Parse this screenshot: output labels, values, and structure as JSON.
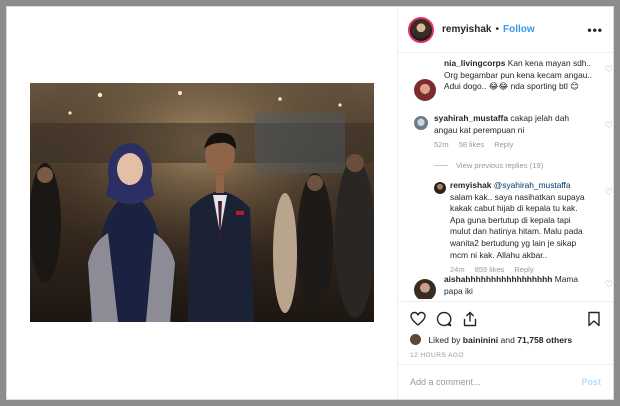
{
  "header": {
    "username": "remyishak",
    "separator": "•",
    "follow_label": "Follow",
    "more_label": "•••"
  },
  "comments": [
    {
      "username": "nia_livingcorps",
      "text": "Kan kena mayan sdh.. Org begambar pun kena kecam angau.. Adui dogo.. 😂😂 nda sporting btl 😊"
    },
    {
      "username": "syahirah_mustaffa",
      "text": "cakap jelah dah angau kat perempuan ni",
      "time": "52m",
      "likes": "58 likes",
      "reply": "Reply"
    },
    {
      "view_replies": "View previous replies (19)"
    },
    {
      "username": "remyishak",
      "mention": "@syahirah_mustaffa",
      "text": "salam kak.. saya nasihatkan supaya kakak cabut hijab di kepala tu kak. Apa guna bertutup di kepala tapi mulut dan hatinya hitam. Malu pada wanita2 bertudung yg lain je sikap mcm ni kak. Allahu akbar..",
      "time": "24m",
      "likes": "859 likes",
      "reply": "Reply"
    },
    {
      "username": "aishahhhhhhhhhhhhhhhhh",
      "text": "Mama papa iki"
    }
  ],
  "likes": {
    "prefix": "Liked by",
    "user": "baininini",
    "and": "and",
    "count": "71,758 others"
  },
  "timestamp": "12 HOURS AGO",
  "add_comment": {
    "placeholder": "Add a comment...",
    "post_label": "Post"
  },
  "colors": {
    "accent": "#3897f0",
    "post_disabled": "#b2dffc",
    "muted": "#999999"
  }
}
